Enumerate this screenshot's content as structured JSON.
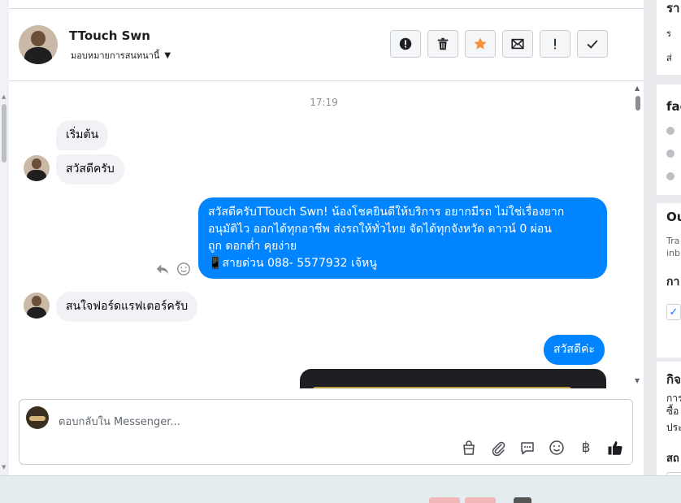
{
  "conversation": {
    "contact_name": "TTouch Swn",
    "assign_label": "มอบหมายการสนทนานี้",
    "timestamp": "17:19"
  },
  "header_actions": [
    {
      "name": "spam-button",
      "icon": "spam-icon"
    },
    {
      "name": "delete-button",
      "icon": "trash-icon"
    },
    {
      "name": "star-button",
      "icon": "star-icon",
      "color": "#f7923a"
    },
    {
      "name": "mark-unread-button",
      "icon": "envelope-icon"
    },
    {
      "name": "follow-up-button",
      "icon": "exclamation-icon"
    },
    {
      "name": "done-button",
      "icon": "check-icon"
    }
  ],
  "messages": [
    {
      "direction": "in",
      "text": "เริ่มต้น"
    },
    {
      "direction": "in",
      "text": "สวัสดีครับ"
    },
    {
      "direction": "out",
      "lines": [
        "สวัสดีครับTTouch Swn! น้องโชคยินดีให้บริการ อยากมีรถ ไม่ใช่เรื่องยาก",
        "อนุมัติไว ออกได้ทุกอาชีพ ส่งรถให้ทั่วไทย จัดได้ทุกจังหวัด ดาวน์ 0  ผ่อน",
        "ถูก ดอกต่ำ คุยง่าย",
        "📱สายด่วน 088- 5577932 เจ้หนู"
      ]
    },
    {
      "direction": "in",
      "text": "สนใจฟอร์ดแรฟเตอร์ครับ"
    },
    {
      "direction": "out",
      "text": "สวัสดีค่ะ"
    }
  ],
  "composer": {
    "placeholder": "ตอบกลับใน Messenger..."
  },
  "composer_tools": [
    "shopping-bag-icon",
    "paperclip-icon",
    "saved-reply-icon",
    "emoji-icon",
    "baht-icon",
    "thumbs-up-icon"
  ],
  "baht_symbol": "฿",
  "sidebar": {
    "card1_title": "รา",
    "card1_line1": "ร",
    "card1_line2": "ส่",
    "card2_title": "fac",
    "card3_title": "Ou",
    "card3_desc1": "Tra",
    "card3_desc2": "inb",
    "card3_label": "กา",
    "card4_title": "กิจ",
    "card4_line1": "การ",
    "card4_line2": "ซื้อ",
    "card4_line3": "ประ",
    "card4_line4": "สถ"
  },
  "colors": {
    "outgoing_bubble": "#0084ff",
    "incoming_bubble": "#f0f2f5",
    "star": "#f7923a",
    "thumbs_up": "#1c1e21"
  }
}
